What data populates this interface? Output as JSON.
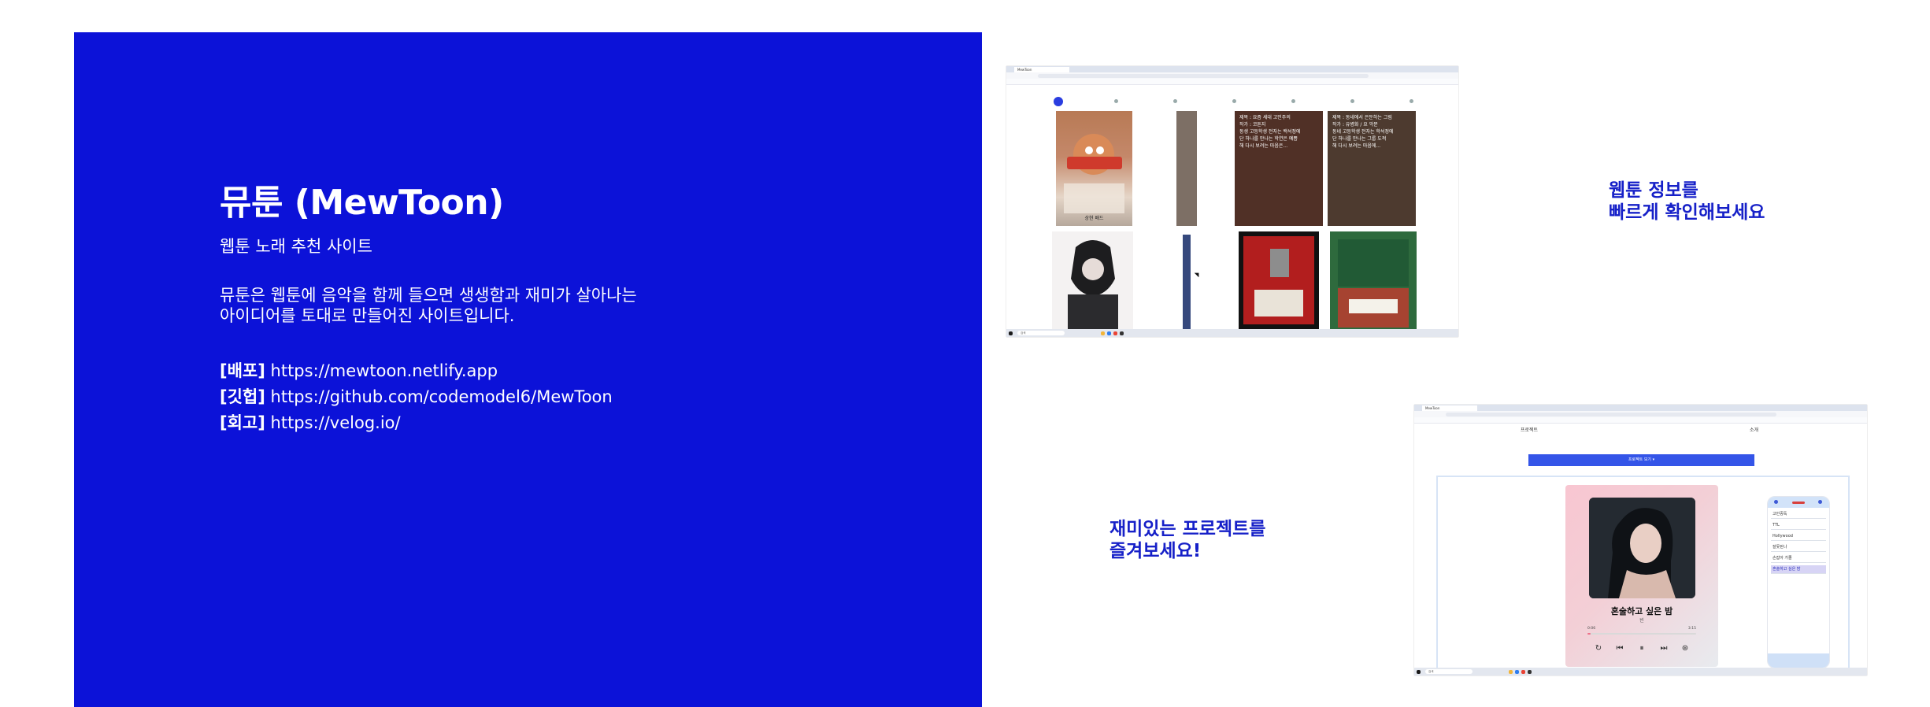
{
  "intro": {
    "title": "뮤툰 (MewToon)",
    "subtitle": "웹툰 노래 추천 사이트",
    "description_line1": "뮤툰은 웹툰에 음악을 함께 들으면 생생함과 재미가 살아나는",
    "description_line2": "아이디어를 토대로 만들어진 사이트입니다.",
    "links": [
      {
        "label": "[배포]",
        "url": "https://mewtoon.netlify.app"
      },
      {
        "label": "[깃헙]",
        "url": "https://github.com/codemodel6/MewToon"
      },
      {
        "label": "[회고]",
        "url": "https://velog.io/"
      }
    ]
  },
  "callouts": {
    "webtoon_line1": "웹툰 정보를",
    "webtoon_line2": "빠르게 확인해보세요",
    "project_line1": "재미있는 프로젝트를",
    "project_line2": "즐겨보세요!"
  },
  "screenshot_webtoon": {
    "tab_title": "MewToon",
    "search_placeholder": "검색",
    "card_1_caption": "상현 배드",
    "card_3_text": [
      "제목 : 요즘 세대 고민주의",
      "작가 : 코튼지",
      "동생 고등학생 전자는 백석정에",
      "단 하나를 만나는 학연은 예쁨",
      "해 다시 보려는 마음은..."
    ],
    "card_4_text": [
      "제목 : 동네에서 은둔하는 그림",
      "작가 : 유병화 / 요 악문",
      "동네 고등학생 전자는 학석정에",
      "단 하나를 만나는 그룹 도적",
      "해 다시 보려는 마음에..."
    ],
    "colors": {
      "active_dot": "#2a3de0"
    }
  },
  "screenshot_player": {
    "tab_title": "MewToon",
    "search_placeholder": "검색",
    "nav_left": "프로젝트",
    "nav_right": "소개",
    "banner": "프로젝트 보기 ▾",
    "song_title": "혼술하고 싶은 밤",
    "song_artist": "빈",
    "time_current": "0:06",
    "time_total": "3:15",
    "progress_ratio": 0.03,
    "playlist": [
      "고민중독",
      "TTL",
      "Hollywood",
      "잘못된나",
      "손잡아 가줄",
      "혼술하고 싶은 밤"
    ],
    "active_track_index": 5,
    "controls": [
      "repeat-icon",
      "previous-icon",
      "pause-icon",
      "next-icon",
      "shuffle-icon"
    ]
  }
}
